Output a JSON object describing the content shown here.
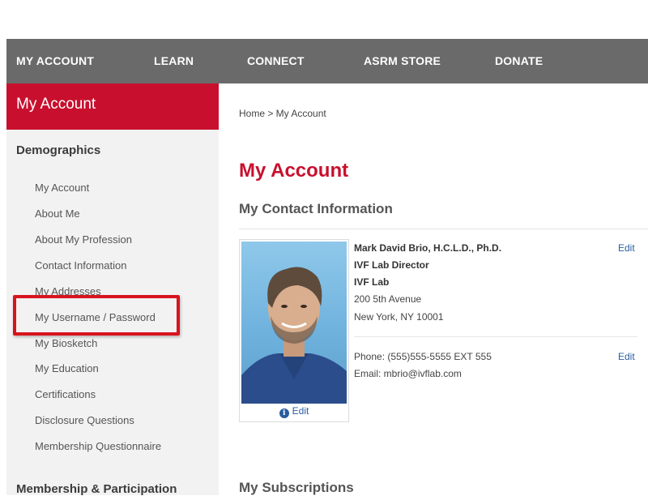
{
  "nav": {
    "items": [
      "MY ACCOUNT",
      "LEARN",
      "CONNECT",
      "ASRM STORE",
      "DONATE"
    ]
  },
  "sidebar": {
    "title": "My Account",
    "sections": [
      {
        "heading": "Demographics",
        "items": [
          "My Account",
          "About Me",
          "About My Profession",
          "Contact Information",
          "My Addresses",
          "My Username / Password",
          "My Biosketch",
          "My Education",
          "Certifications",
          "Disclosure Questions",
          "Membership Questionnaire"
        ]
      },
      {
        "heading": "Membership & Participation"
      }
    ]
  },
  "main": {
    "breadcrumb": "Home > My Account",
    "title": "My Account",
    "contact_heading": "My Contact Information",
    "photo_edit_label": "Edit",
    "contact": {
      "name": "Mark David Brio, H.C.L.D., Ph.D.",
      "job_title": "IVF Lab Director",
      "organization": "IVF Lab",
      "address_line1": "200 5th Avenue",
      "address_line2": "New York, NY  10001",
      "phone": "Phone: (555)555-5555 EXT 555",
      "email": "Email: mbrio@ivflab.com",
      "edit_label": "Edit"
    },
    "subscriptions_heading": "My Subscriptions"
  },
  "colors": {
    "brand_red": "#c8102e",
    "nav_gray": "#6a6a6a",
    "highlight_red": "#d8141f",
    "link_blue": "#2a5d9f"
  }
}
